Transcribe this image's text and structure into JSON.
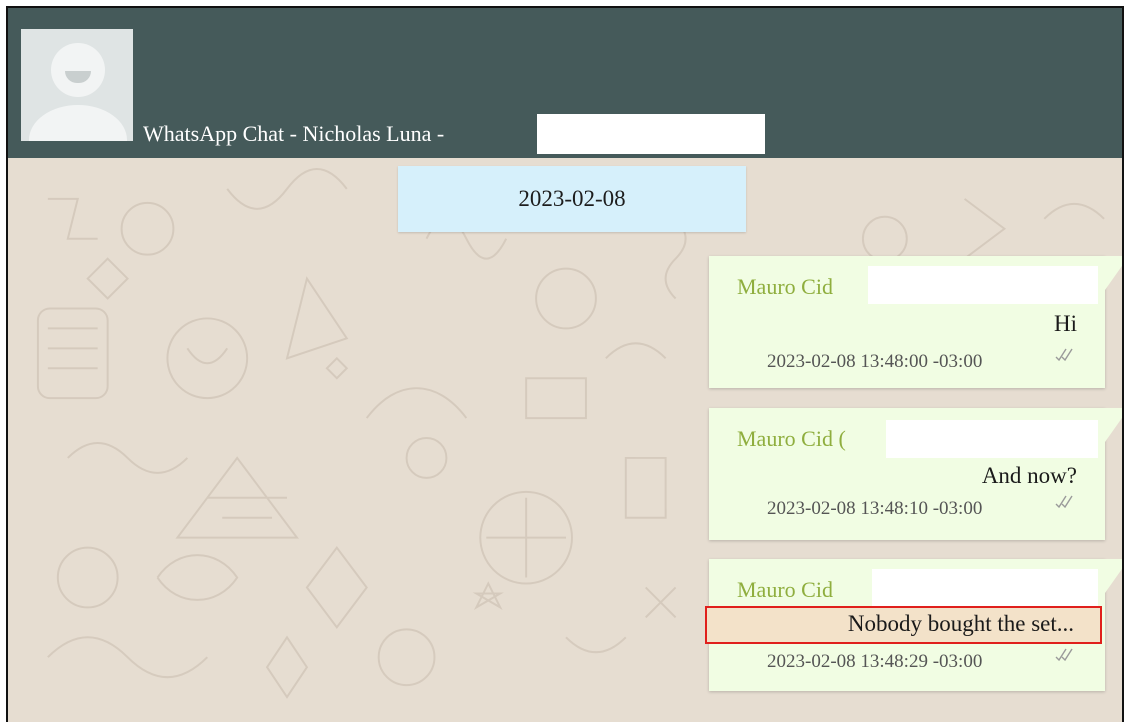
{
  "header": {
    "title": "WhatsApp Chat - Nicholas Luna -"
  },
  "date_chip": "2023-02-08",
  "messages": [
    {
      "sender": "Mauro Cid",
      "text": "Hi",
      "time": "2023-02-08 13:48:00 -03:00"
    },
    {
      "sender": "Mauro Cid (",
      "text": "And now?",
      "time": "2023-02-08 13:48:10 -03:00"
    },
    {
      "sender": "Mauro Cid",
      "text": "Nobody bought the set...",
      "time": "2023-02-08 13:48:29 -03:00"
    }
  ],
  "icons": {
    "avatar": "default-avatar-icon",
    "read_receipt": "double-check-icon"
  },
  "colors": {
    "header": "#455a5a",
    "date_chip": "#d6f0fb",
    "message_bubble": "#f1fde3",
    "sender_name": "#8fae3e",
    "highlight_border": "#e0201c",
    "highlight_fill": "#f3e2c9"
  }
}
